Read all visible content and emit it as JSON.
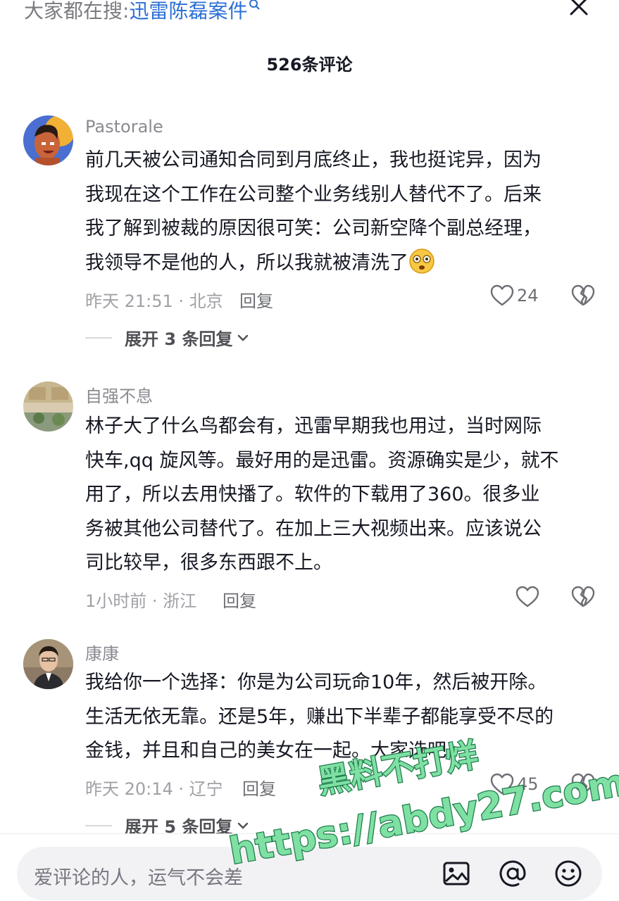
{
  "search_hint": {
    "prefix": "大家都在搜:",
    "keyword": "迅雷陈磊案件"
  },
  "header": {
    "comment_count": "526条评论"
  },
  "comments": [
    {
      "username": "Pastorale",
      "lines": [
        "前几天被公司通知合同到月底终止，我也挺诧异，因为",
        "我现在这个工作在公司整个业务线别人替代不了。后来",
        "我了解到被裁的原因很可笑：公司新空降个副总经理，",
        "我领导不是他的人，所以我就被清洗了"
      ],
      "time_location": "昨天 21:51 · 北京",
      "reply_label": "回复",
      "likes": "24",
      "expand_label": "展开 3 条回复"
    },
    {
      "username": "自强不息",
      "lines": [
        "林子大了什么鸟都会有，迅雷早期我也用过，当时网际",
        "快车,qq 旋风等。最好用的是迅雷。资源确实是少，就不",
        "用了，所以去用快播了。软件的下载用了360。很多业",
        "务被其他公司替代了。在加上三大视频出来。应该说公",
        "司比较早，很多东西跟不上。"
      ],
      "time_location": "1小时前 · 浙江",
      "reply_label": "回复",
      "likes": ""
    },
    {
      "username": "康康",
      "lines": [
        "我给你一个选择：你是为公司玩命10年，然后被开除。",
        "生活无依无靠。还是5年，赚出下半辈子都能享受不尽的",
        "金钱，并且和自己的美女在一起。大家选吧"
      ],
      "time_location": "昨天 20:14 · 辽宁",
      "reply_label": "回复",
      "likes": "45",
      "expand_label": "展开 5 条回复"
    }
  ],
  "input": {
    "placeholder": "爱评论的人，运气不会差"
  },
  "watermark": {
    "line1": "黑料不打烊",
    "line2": "https://abdy27.com"
  },
  "icons": [
    "search-icon",
    "close-icon",
    "heart-icon",
    "broken-heart-icon",
    "chevron-down-icon",
    "image-icon",
    "at-icon",
    "emoji-icon"
  ],
  "colors": {
    "accent_link": "#2b6fd6",
    "watermark_fill": "#7ee0a2",
    "watermark_stroke": "#1f7a4c"
  }
}
